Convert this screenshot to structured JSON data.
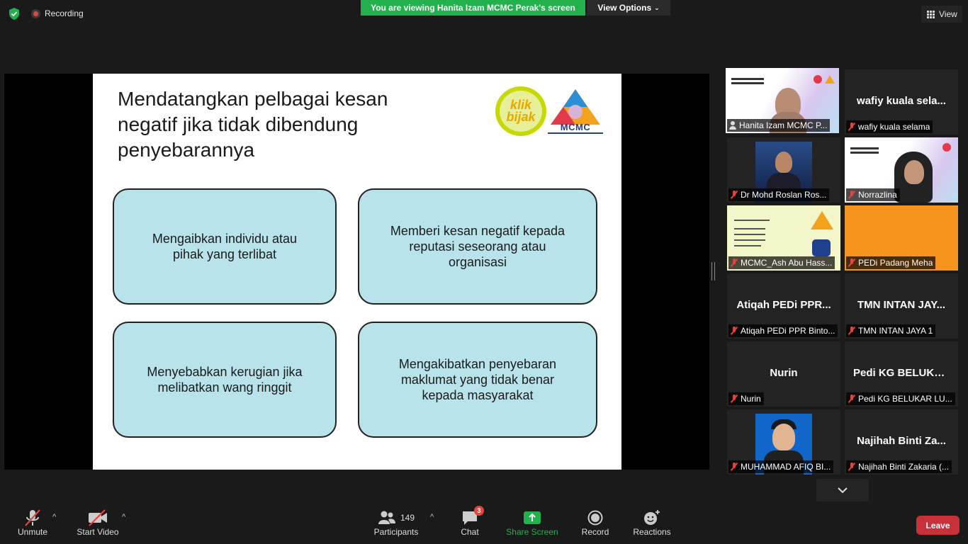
{
  "top_bar": {
    "recording_label": "Recording",
    "viewing_banner": "You are viewing Hanita Izam MCMC Perak's screen",
    "view_options_label": "View Options",
    "view_label": "View"
  },
  "slide": {
    "title": "Mendatangkan pelbagai kesan negatif jika tidak dibendung penyebarannya",
    "logo_klik": {
      "line1": "klik",
      "line2": "bijak"
    },
    "logo_mcmc": "MCMC",
    "boxes": [
      "Mengaibkan individu atau pihak yang terlibat",
      "Memberi kesan negatif kepada reputasi seseorang atau organisasi",
      "Menyebabkan kerugian jika melibatkan wang ringgit",
      "Mengakibatkan penyebaran maklumat yang tidak benar kepada masyarakat"
    ]
  },
  "participants": [
    {
      "label": "Hanita Izam MCMC P...",
      "center": "",
      "video": true,
      "muted": false
    },
    {
      "label": "wafiy kuala selama",
      "center": "wafiy kuala sela...",
      "video": false,
      "muted": true
    },
    {
      "label": "Dr Mohd Roslan Ros...",
      "center": "",
      "video": true,
      "muted": true
    },
    {
      "label": "Norrazlina",
      "center": "",
      "video": true,
      "muted": true
    },
    {
      "label": "MCMC_Ash Abu Hass...",
      "center": "",
      "video": true,
      "muted": true
    },
    {
      "label": "PEDi Padang Meha",
      "center": "",
      "video": true,
      "muted": true
    },
    {
      "label": "Atiqah PEDi PPR Binto...",
      "center": "Atiqah PEDi PPR...",
      "video": false,
      "muted": true
    },
    {
      "label": "TMN INTAN JAYA 1",
      "center": "TMN INTAN JAY...",
      "video": false,
      "muted": true
    },
    {
      "label": "Nurin",
      "center": "Nurin",
      "video": false,
      "muted": true
    },
    {
      "label": "Pedi KG BELUKAR LU...",
      "center": "Pedi KG BELUKA...",
      "video": false,
      "muted": true
    },
    {
      "label": "MUHAMMAD AFIQ BI...",
      "center": "",
      "video": true,
      "muted": true
    },
    {
      "label": "Najihah Binti Zakaria (...",
      "center": "Najihah Binti Za...",
      "video": false,
      "muted": true
    }
  ],
  "toolbar": {
    "unmute_label": "Unmute",
    "start_video_label": "Start Video",
    "participants_label": "Participants",
    "participants_count": "149",
    "chat_label": "Chat",
    "chat_badge": "3",
    "share_screen_label": "Share Screen",
    "record_label": "Record",
    "reactions_label": "Reactions",
    "leave_label": "Leave"
  },
  "colors": {
    "banner_green": "#23b14d",
    "leave_red": "#c7313a",
    "active_speaker": "#c6e03c",
    "slide_box": "#b9e3ea"
  }
}
